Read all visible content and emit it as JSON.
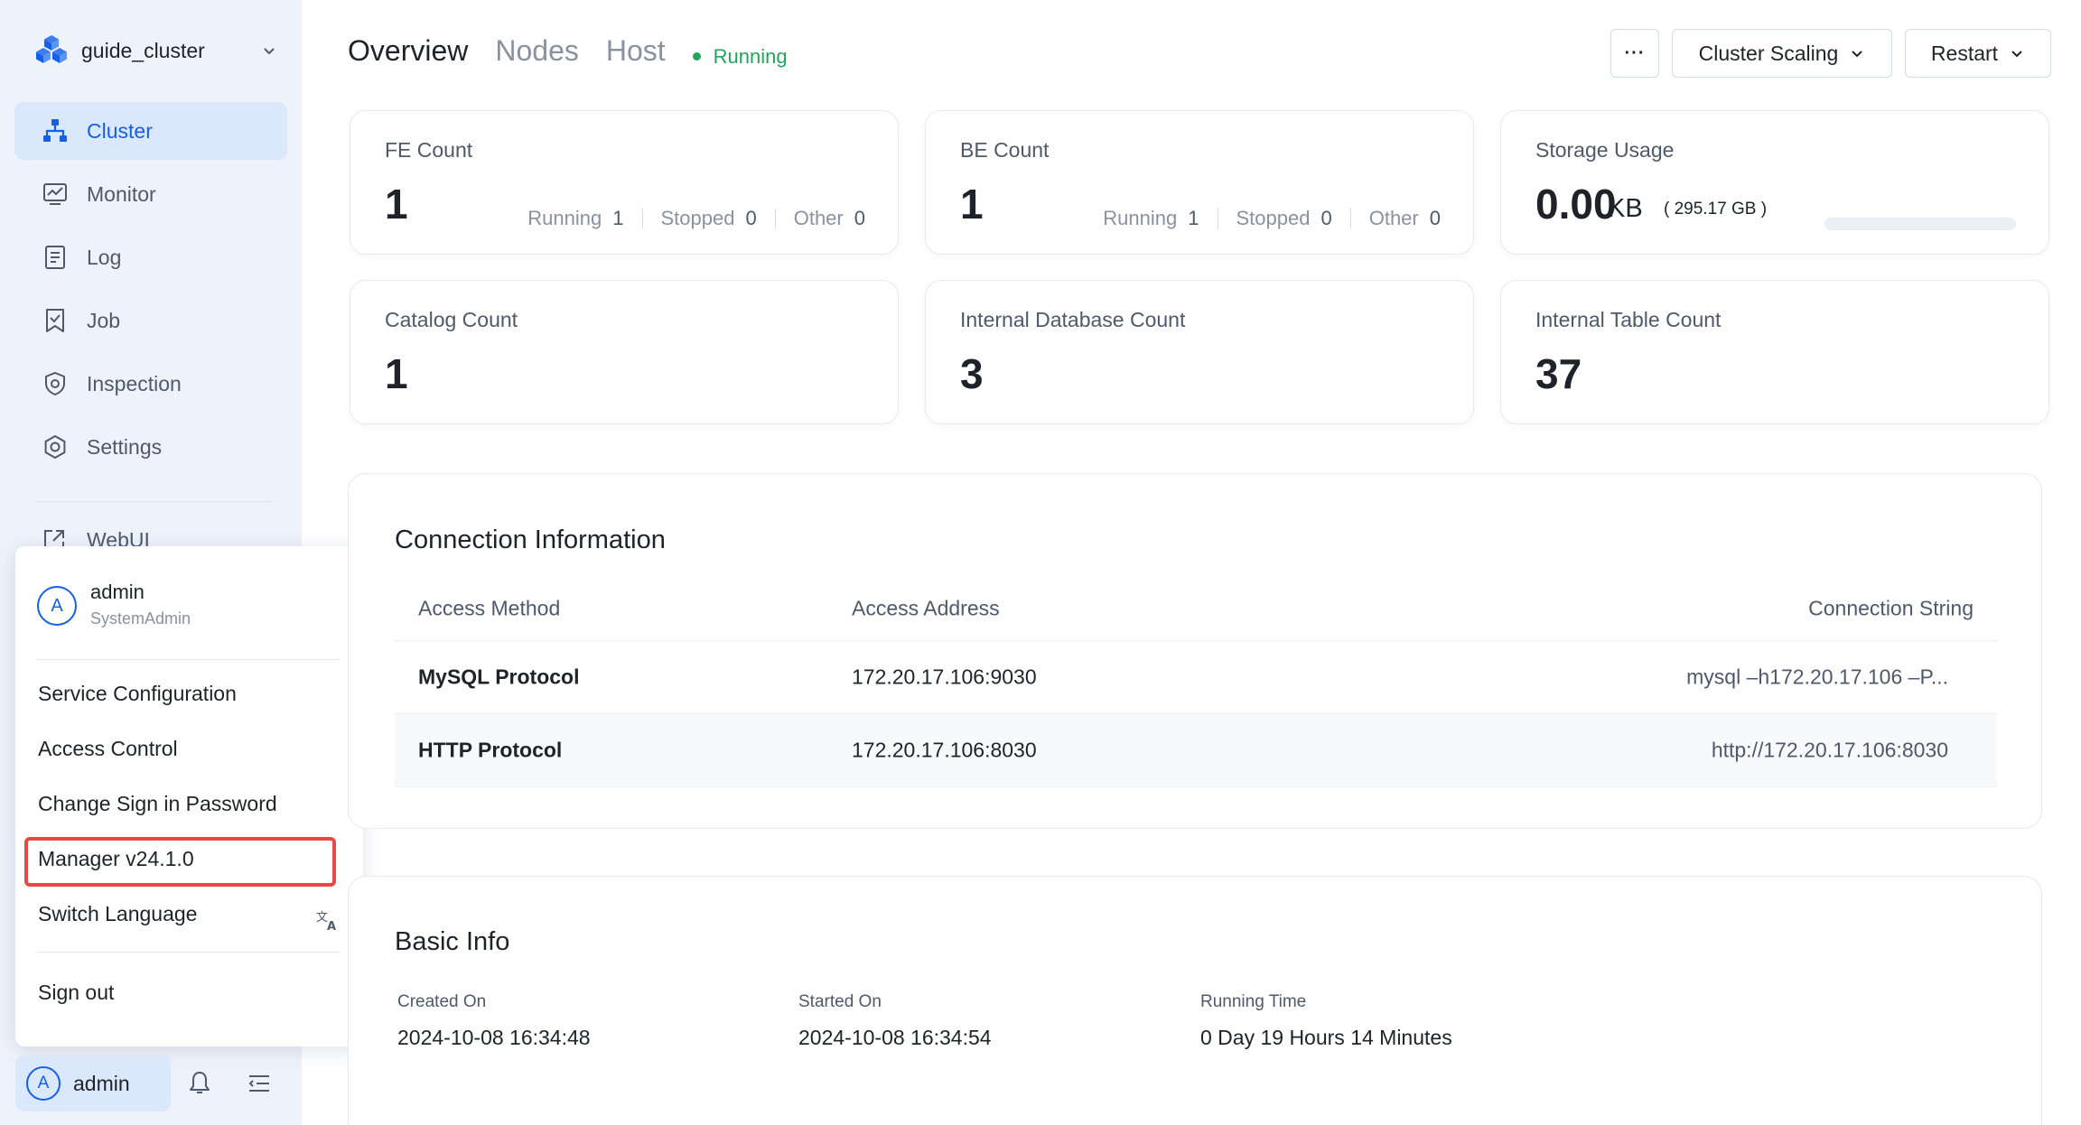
{
  "sidebar": {
    "cluster_name": "guide_cluster",
    "nav": [
      {
        "label": "Cluster",
        "icon": "cluster-icon",
        "active": true
      },
      {
        "label": "Monitor",
        "icon": "monitor-icon",
        "active": false
      },
      {
        "label": "Log",
        "icon": "log-icon",
        "active": false
      },
      {
        "label": "Job",
        "icon": "job-icon",
        "active": false
      },
      {
        "label": "Inspection",
        "icon": "inspection-icon",
        "active": false
      },
      {
        "label": "Settings",
        "icon": "settings-icon",
        "active": false
      }
    ],
    "webui_label": "WebUI",
    "user_bar": {
      "avatar_letter": "A",
      "name": "admin"
    }
  },
  "user_menu": {
    "avatar_letter": "A",
    "name": "admin",
    "role": "SystemAdmin",
    "items": {
      "service_config": "Service Configuration",
      "access_control": "Access Control",
      "change_password": "Change Sign in Password",
      "version": "Manager v24.1.0",
      "switch_language": "Switch Language",
      "sign_out": "Sign out"
    }
  },
  "header": {
    "tabs": [
      "Overview",
      "Nodes",
      "Host"
    ],
    "active_tab": "Overview",
    "status": "Running",
    "more_label": "···",
    "scaling_label": "Cluster Scaling",
    "restart_label": "Restart"
  },
  "stats": {
    "fe": {
      "label": "FE Count",
      "value": "1",
      "running_label": "Running",
      "running": "1",
      "stopped_label": "Stopped",
      "stopped": "0",
      "other_label": "Other",
      "other": "0"
    },
    "be": {
      "label": "BE Count",
      "value": "1",
      "running_label": "Running",
      "running": "1",
      "stopped_label": "Stopped",
      "stopped": "0",
      "other_label": "Other",
      "other": "0"
    },
    "storage": {
      "label": "Storage Usage",
      "value": "0.00",
      "unit": "KB",
      "total": "( 295.17 GB )",
      "usage_fraction": 0.0
    },
    "catalog": {
      "label": "Catalog Count",
      "value": "1"
    },
    "database": {
      "label": "Internal Database Count",
      "value": "3"
    },
    "table": {
      "label": "Internal Table Count",
      "value": "37"
    }
  },
  "connection": {
    "title": "Connection Information",
    "columns": [
      "Access Method",
      "Access Address",
      "Connection String"
    ],
    "rows": [
      {
        "method": "MySQL Protocol",
        "address": "172.20.17.106:9030",
        "string": "mysql –h172.20.17.106 –P..."
      },
      {
        "method": "HTTP Protocol",
        "address": "172.20.17.106:8030",
        "string": "http://172.20.17.106:8030"
      }
    ]
  },
  "basic_info": {
    "title": "Basic Info",
    "created_label": "Created On",
    "created": "2024-10-08 16:34:48",
    "started_label": "Started On",
    "started": "2024-10-08 16:34:54",
    "running_label": "Running Time",
    "running": "0 Day 19 Hours 14 Minutes"
  },
  "colors": {
    "accent": "#1660e8",
    "running": "#22a45d",
    "highlight": "#e84848",
    "sidebar_bg": "#eef3fb"
  }
}
